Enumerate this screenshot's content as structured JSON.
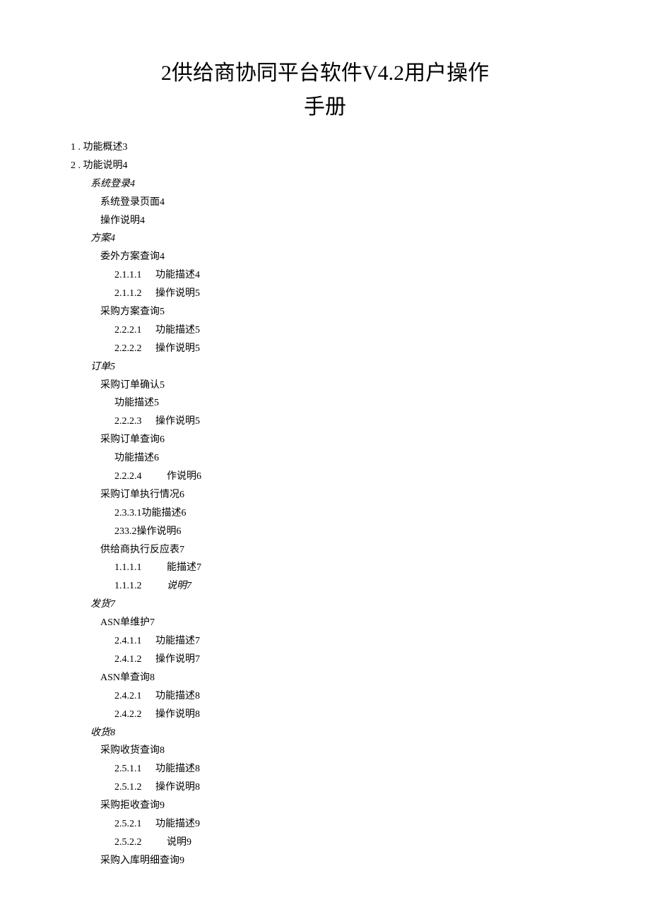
{
  "title": "2供给商协同平台软件V4.2用户操作手册",
  "toc": {
    "top": [
      {
        "num": "1",
        "label": ". 功能概述3"
      },
      {
        "num": "2",
        "label": ". 功能说明4"
      }
    ],
    "sections": [
      {
        "heading": "系统登录4",
        "items": [
          {
            "level": 2,
            "text": "系统登录页面4"
          },
          {
            "level": 2,
            "text": "操作说明4"
          }
        ]
      },
      {
        "heading": "方案4",
        "items": [
          {
            "level": 2,
            "text": "委外方案查询4"
          },
          {
            "level": 3,
            "num": "2.1.1.1",
            "text": "功能描述4"
          },
          {
            "level": 3,
            "num": "2.1.1.2",
            "text": "操作说明5"
          },
          {
            "level": 2,
            "text": "采购方案查询5"
          },
          {
            "level": 3,
            "num": "2.2.2.1",
            "text": "功能描述5"
          },
          {
            "level": 3,
            "num": "2.2.2.2",
            "text": "操作说明5"
          }
        ]
      },
      {
        "heading": "订单5",
        "items": [
          {
            "level": 2,
            "text": "采购订单确认5"
          },
          {
            "level": 3,
            "text": "功能描述5"
          },
          {
            "level": 3,
            "num": "2.2.2.3",
            "text": "操作说明5"
          },
          {
            "level": 2,
            "text": "采购订单查询6"
          },
          {
            "level": 3,
            "text": "功能描述6"
          },
          {
            "level": 3,
            "num": "2.2.2.4",
            "wide": true,
            "text": "作说明6"
          },
          {
            "level": 2,
            "text": "采购订单执行情况6"
          },
          {
            "level": 3,
            "text": "2.3.3.1功能描述6"
          },
          {
            "level": 3,
            "text": "233.2操作说明6"
          },
          {
            "level": 2,
            "text": "供给商执行反应表7"
          },
          {
            "level": 3,
            "num": "1.1.1.1",
            "wide": true,
            "text": "能描述7"
          },
          {
            "level": 3,
            "num": "1.1.1.2",
            "wide": true,
            "text": "说明7",
            "italic": true
          }
        ]
      },
      {
        "heading": "发货7",
        "items": [
          {
            "level": 2,
            "text": "ASN单维护7",
            "italicPage": true
          },
          {
            "level": 3,
            "num": "2.4.1.1",
            "text": "功能描述7"
          },
          {
            "level": 3,
            "num": "2.4.1.2",
            "text": "操作说明7"
          },
          {
            "level": 2,
            "text": "ASN单查询8"
          },
          {
            "level": 3,
            "num": "2.4.2.1",
            "text": "功能描述8"
          },
          {
            "level": 3,
            "num": "2.4.2.2",
            "text": "操作说明8"
          }
        ]
      },
      {
        "heading": "收货8",
        "items": [
          {
            "level": 2,
            "text": "采购收货查询8"
          },
          {
            "level": 3,
            "num": "2.5.1.1",
            "text": "功能描述8"
          },
          {
            "level": 3,
            "num": "2.5.1.2",
            "text": "操作说明8"
          },
          {
            "level": 2,
            "text": "采购拒收查询9"
          },
          {
            "level": 3,
            "num": "2.5.2.1",
            "text": "功能描述9"
          },
          {
            "level": 3,
            "num": "2.5.2.2",
            "wide": true,
            "text": "说明9"
          },
          {
            "level": 2,
            "text": "采购入库明细查询9"
          }
        ]
      }
    ]
  }
}
